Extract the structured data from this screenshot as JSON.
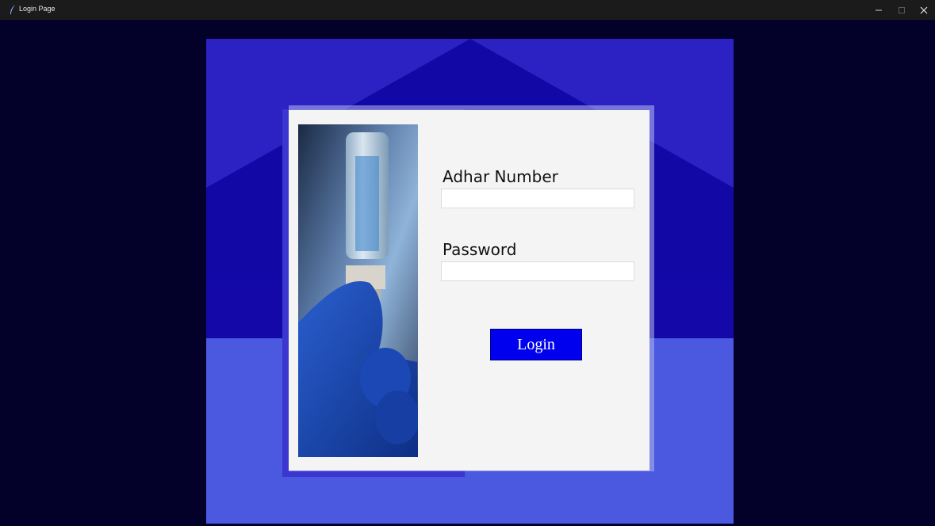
{
  "window": {
    "title": "Login Page",
    "minimize_glyph": "–",
    "maximize_glyph": "□",
    "close_glyph": "✕"
  },
  "form": {
    "adhar_label": "Adhar Number",
    "adhar_value": "",
    "password_label": "Password",
    "password_value": "",
    "login_label": "Login"
  },
  "colors": {
    "background": "#03002a",
    "accent_button": "#0000ee",
    "card": "#f4f4f4"
  },
  "icons": [
    "feather-icon",
    "minimize-icon",
    "maximize-icon",
    "close-icon"
  ]
}
